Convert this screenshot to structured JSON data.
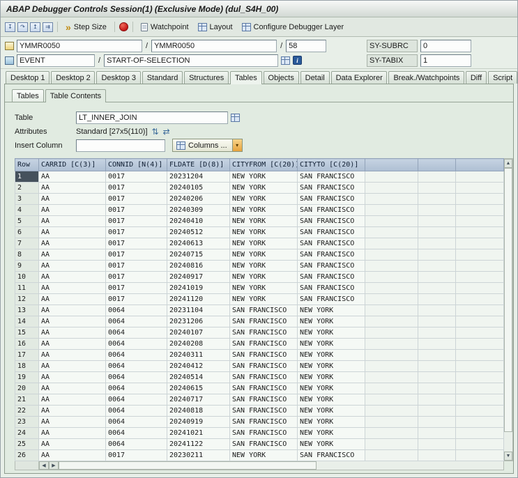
{
  "window": {
    "title": "ABAP Debugger Controls Session(1)  (Exclusive Mode) (dul_S4H_00)"
  },
  "toolbar": {
    "step_size_label": "Step Size",
    "watchpoint_label": "Watchpoint",
    "layout_label": "Layout",
    "configure_label": "Configure Debugger Layer"
  },
  "context": {
    "separator": "/",
    "program_value": "YMMR0050",
    "include_value": "YMMR0050",
    "line_value": "58",
    "sy_subrc_label": "SY-SUBRC",
    "sy_subrc_value": "0",
    "event_label": "EVENT",
    "event_value": "START-OF-SELECTION",
    "sy_tabix_label": "SY-TABIX",
    "sy_tabix_value": "1"
  },
  "main_tabs": {
    "items": [
      "Desktop 1",
      "Desktop 2",
      "Desktop 3",
      "Standard",
      "Structures",
      "Tables",
      "Objects",
      "Detail",
      "Data Explorer",
      "Break./Watchpoints",
      "Diff",
      "Script"
    ],
    "active": "Tables"
  },
  "sub_tabs": {
    "items": [
      "Tables",
      "Table Contents"
    ],
    "active": "Table Contents"
  },
  "form": {
    "table_label": "Table",
    "table_value": "LT_INNER_JOIN",
    "attributes_label": "Attributes",
    "attributes_value": "Standard [27x5(110)]",
    "insert_column_label": "Insert Column",
    "insert_column_value": "",
    "columns_button_label": "Columns ..."
  },
  "grid": {
    "columns": [
      "Row",
      "CARRID [C(3)]",
      "CONNID [N(4)]",
      "FLDATE [D(8)]",
      "CITYFROM [C(20)]",
      "CITYTO [C(20)]"
    ],
    "filler_columns": 3,
    "selected_row": "1",
    "rows": [
      [
        "1",
        "AA",
        "0017",
        "20231204",
        "NEW YORK",
        "SAN FRANCISCO"
      ],
      [
        "2",
        "AA",
        "0017",
        "20240105",
        "NEW YORK",
        "SAN FRANCISCO"
      ],
      [
        "3",
        "AA",
        "0017",
        "20240206",
        "NEW YORK",
        "SAN FRANCISCO"
      ],
      [
        "4",
        "AA",
        "0017",
        "20240309",
        "NEW YORK",
        "SAN FRANCISCO"
      ],
      [
        "5",
        "AA",
        "0017",
        "20240410",
        "NEW YORK",
        "SAN FRANCISCO"
      ],
      [
        "6",
        "AA",
        "0017",
        "20240512",
        "NEW YORK",
        "SAN FRANCISCO"
      ],
      [
        "7",
        "AA",
        "0017",
        "20240613",
        "NEW YORK",
        "SAN FRANCISCO"
      ],
      [
        "8",
        "AA",
        "0017",
        "20240715",
        "NEW YORK",
        "SAN FRANCISCO"
      ],
      [
        "9",
        "AA",
        "0017",
        "20240816",
        "NEW YORK",
        "SAN FRANCISCO"
      ],
      [
        "10",
        "AA",
        "0017",
        "20240917",
        "NEW YORK",
        "SAN FRANCISCO"
      ],
      [
        "11",
        "AA",
        "0017",
        "20241019",
        "NEW YORK",
        "SAN FRANCISCO"
      ],
      [
        "12",
        "AA",
        "0017",
        "20241120",
        "NEW YORK",
        "SAN FRANCISCO"
      ],
      [
        "13",
        "AA",
        "0064",
        "20231104",
        "SAN FRANCISCO",
        "NEW YORK"
      ],
      [
        "14",
        "AA",
        "0064",
        "20231206",
        "SAN FRANCISCO",
        "NEW YORK"
      ],
      [
        "15",
        "AA",
        "0064",
        "20240107",
        "SAN FRANCISCO",
        "NEW YORK"
      ],
      [
        "16",
        "AA",
        "0064",
        "20240208",
        "SAN FRANCISCO",
        "NEW YORK"
      ],
      [
        "17",
        "AA",
        "0064",
        "20240311",
        "SAN FRANCISCO",
        "NEW YORK"
      ],
      [
        "18",
        "AA",
        "0064",
        "20240412",
        "SAN FRANCISCO",
        "NEW YORK"
      ],
      [
        "19",
        "AA",
        "0064",
        "20240514",
        "SAN FRANCISCO",
        "NEW YORK"
      ],
      [
        "20",
        "AA",
        "0064",
        "20240615",
        "SAN FRANCISCO",
        "NEW YORK"
      ],
      [
        "21",
        "AA",
        "0064",
        "20240717",
        "SAN FRANCISCO",
        "NEW YORK"
      ],
      [
        "22",
        "AA",
        "0064",
        "20240818",
        "SAN FRANCISCO",
        "NEW YORK"
      ],
      [
        "23",
        "AA",
        "0064",
        "20240919",
        "SAN FRANCISCO",
        "NEW YORK"
      ],
      [
        "24",
        "AA",
        "0064",
        "20241021",
        "SAN FRANCISCO",
        "NEW YORK"
      ],
      [
        "25",
        "AA",
        "0064",
        "20241122",
        "SAN FRANCISCO",
        "NEW YORK"
      ],
      [
        "26",
        "AA",
        "0017",
        "20230211",
        "NEW YORK",
        "SAN FRANCISCO"
      ]
    ]
  },
  "icons": {
    "step_into": "↧",
    "step_over": "↷",
    "step_return": "↥",
    "continue": "⇉",
    "step_size": "»",
    "info": "i",
    "sort": "⇅",
    "swap": "⇄",
    "chevron_down": "▾",
    "left_arrow": "◀",
    "right_arrow": "▶",
    "up_arrow": "▲",
    "down_arrow": "▼"
  },
  "colors": {
    "panel_bg": "#e1ebe1",
    "window_bg": "#e8efe8",
    "grid_header_bg": "#b9c8da",
    "selected_row_bg": "#45515c",
    "stop_red": "#c41818",
    "info_blue": "#2a5a9a",
    "dropdown_orange": "#e8a33d"
  }
}
